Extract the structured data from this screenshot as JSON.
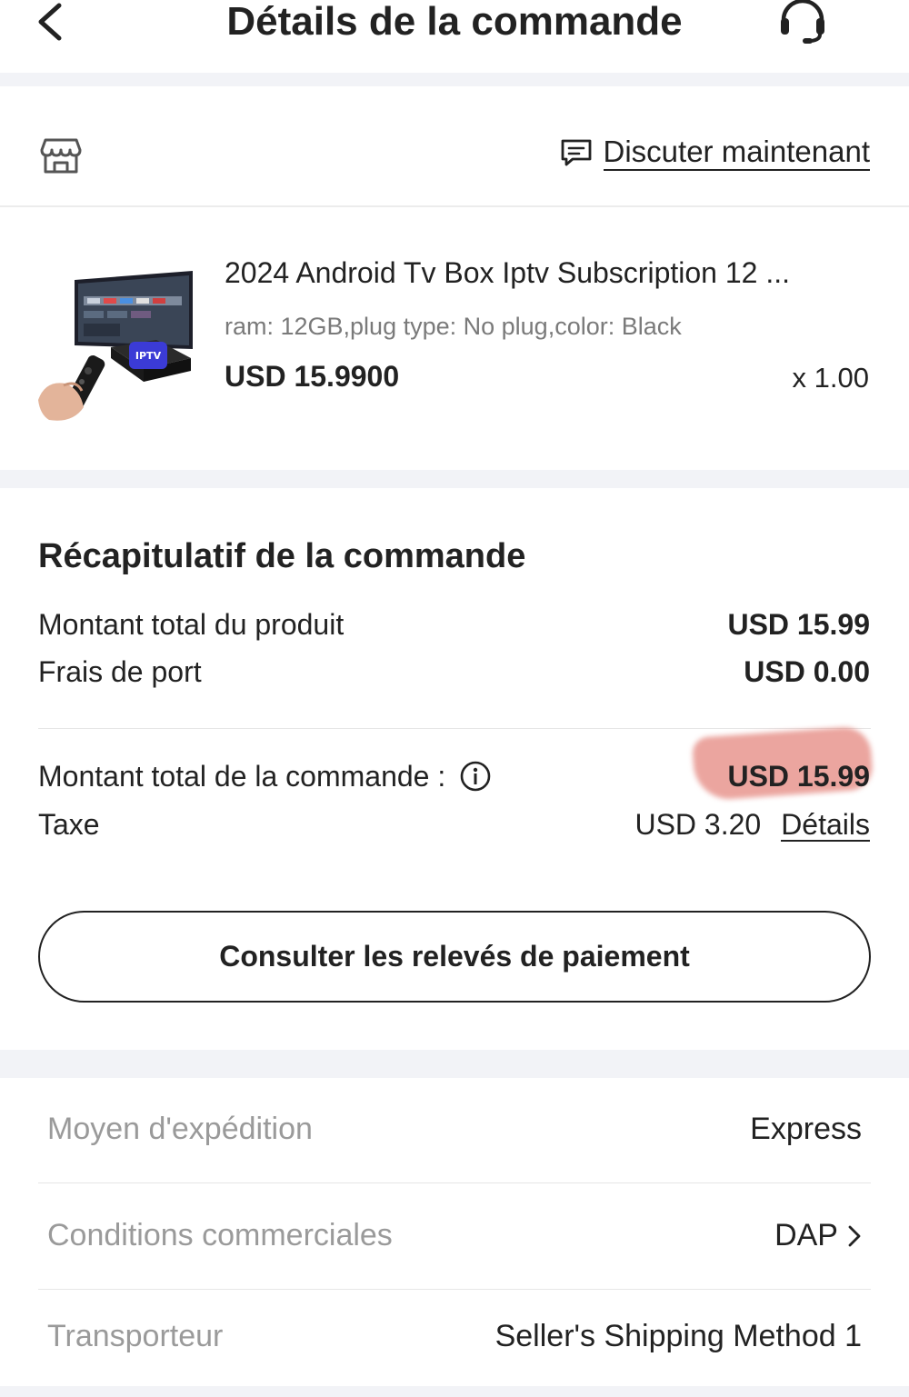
{
  "header": {
    "title": "Détails de la commande",
    "back_icon": "chevron-left-icon",
    "support_icon": "headset-icon"
  },
  "store": {
    "store_icon": "store-icon",
    "chat_icon": "chat-icon",
    "chat_label": "Discuter maintenant"
  },
  "product": {
    "title": "2024 Android Tv Box Iptv Subscription 12 ...",
    "attributes": "ram: 12GB,plug type: No plug,color: Black",
    "price": "USD 15.9900",
    "quantity": "x 1.00"
  },
  "summary": {
    "title": "Récapitulatif de la commande",
    "product_total_label": "Montant total du produit",
    "product_total_value": "USD 15.99",
    "shipping_label": "Frais de port",
    "shipping_value": "USD 0.00",
    "order_total_label": "Montant total de la commande :",
    "order_total_value": "USD 15.99",
    "tax_label": "Taxe",
    "tax_value": "USD 3.20",
    "tax_details_label": "Détails",
    "payment_button_label": "Consulter les relevés de paiement"
  },
  "shipping": {
    "rows": [
      {
        "label": "Moyen d'expédition",
        "value": "Express"
      },
      {
        "label": "Conditions commerciales",
        "value": "DAP"
      },
      {
        "label": "Transporteur",
        "value": "Seller's Shipping Method 1"
      }
    ]
  },
  "colors": {
    "text": "#222222",
    "muted": "#9a9a9a",
    "separator": "#f2f3f7",
    "highlight": "#de6e64",
    "iptv_badge": "#3b3bd6"
  }
}
